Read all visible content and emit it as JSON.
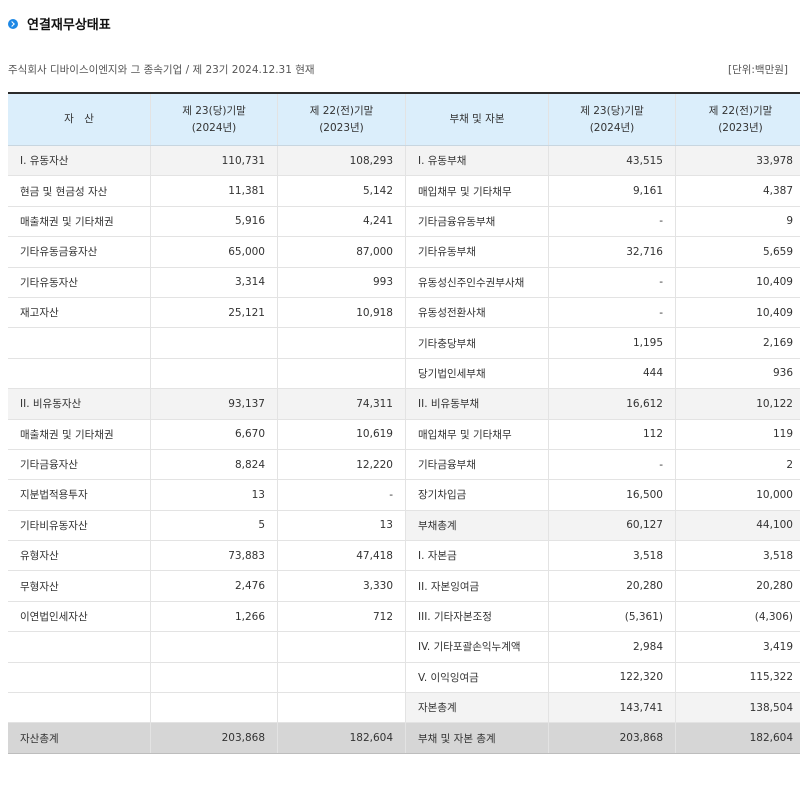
{
  "title": "연결재무상태표",
  "company_line": "주식회사 디바이스이엔지와 그 종속기업 / 제 23기 2024.12.31 현재",
  "unit": "[단위:백만원]",
  "headers": {
    "assets": "자　산",
    "cur_line1": "제 23(당)기말",
    "cur_line2": "(2024년)",
    "prev_line1": "제 22(전)기말",
    "prev_line2": "(2023년)",
    "liab": "부채 및 자본"
  },
  "rows": [
    {
      "a": "I. 유동자산",
      "a1": "110,731",
      "a2": "108,293",
      "l": "I. 유동부채",
      "l1": "43,515",
      "l2": "33,978",
      "grey": true
    },
    {
      "a": "현금 및 현금성 자산",
      "a1": "11,381",
      "a2": "5,142",
      "l": "매입채무 및 기타채무",
      "l1": "9,161",
      "l2": "4,387"
    },
    {
      "a": "매출채권 및 기타채권",
      "a1": "5,916",
      "a2": "4,241",
      "l": "기타금융유동부채",
      "l1": "-",
      "l2": "9"
    },
    {
      "a": "기타유동금융자산",
      "a1": "65,000",
      "a2": "87,000",
      "l": "기타유동부채",
      "l1": "32,716",
      "l2": "5,659"
    },
    {
      "a": "기타유동자산",
      "a1": "3,314",
      "a2": "993",
      "l": "유동성신주인수권부사채",
      "l1": "-",
      "l2": "10,409"
    },
    {
      "a": "재고자산",
      "a1": "25,121",
      "a2": "10,918",
      "l": "유동성전환사채",
      "l1": "-",
      "l2": "10,409"
    },
    {
      "a": "",
      "a1": "",
      "a2": "",
      "l": "기타충당부채",
      "l1": "1,195",
      "l2": "2,169"
    },
    {
      "a": "",
      "a1": "",
      "a2": "",
      "l": "당기법인세부채",
      "l1": "444",
      "l2": "936"
    },
    {
      "a": "II. 비유동자산",
      "a1": "93,137",
      "a2": "74,311",
      "l": "II. 비유동부채",
      "l1": "16,612",
      "l2": "10,122",
      "grey": true
    },
    {
      "a": "매출채권 및 기타채권",
      "a1": "6,670",
      "a2": "10,619",
      "l": "매입채무 및 기타채무",
      "l1": "112",
      "l2": "119"
    },
    {
      "a": "기타금융자산",
      "a1": "8,824",
      "a2": "12,220",
      "l": "기타금융부채",
      "l1": "-",
      "l2": "2"
    },
    {
      "a": "지분법적용투자",
      "a1": "13",
      "a2": "-",
      "l": "장기차입금",
      "l1": "16,500",
      "l2": "10,000"
    },
    {
      "a": "기타비유동자산",
      "a1": "5",
      "a2": "13",
      "l": "부채총계",
      "l1": "60,127",
      "l2": "44,100",
      "lhl": true
    },
    {
      "a": "유형자산",
      "a1": "73,883",
      "a2": "47,418",
      "l": "I. 자본금",
      "l1": "3,518",
      "l2": "3,518"
    },
    {
      "a": "무형자산",
      "a1": "2,476",
      "a2": "3,330",
      "l": "II. 자본잉여금",
      "l1": "20,280",
      "l2": "20,280"
    },
    {
      "a": "이연법인세자산",
      "a1": "1,266",
      "a2": "712",
      "l": "III. 기타자본조정",
      "l1": "(5,361)",
      "l2": "(4,306)"
    },
    {
      "a": "",
      "a1": "",
      "a2": "",
      "l": "IV. 기타포괄손익누계액",
      "l1": "2,984",
      "l2": "3,419"
    },
    {
      "a": "",
      "a1": "",
      "a2": "",
      "l": "V. 이익잉여금",
      "l1": "122,320",
      "l2": "115,322"
    },
    {
      "a": "",
      "a1": "",
      "a2": "",
      "l": "자본총계",
      "l1": "143,741",
      "l2": "138,504",
      "lhl": true
    }
  ],
  "total": {
    "a": "자산총계",
    "a1": "203,868",
    "a2": "182,604",
    "l": "부채 및 자본 총계",
    "l1": "203,868",
    "l2": "182,604"
  }
}
